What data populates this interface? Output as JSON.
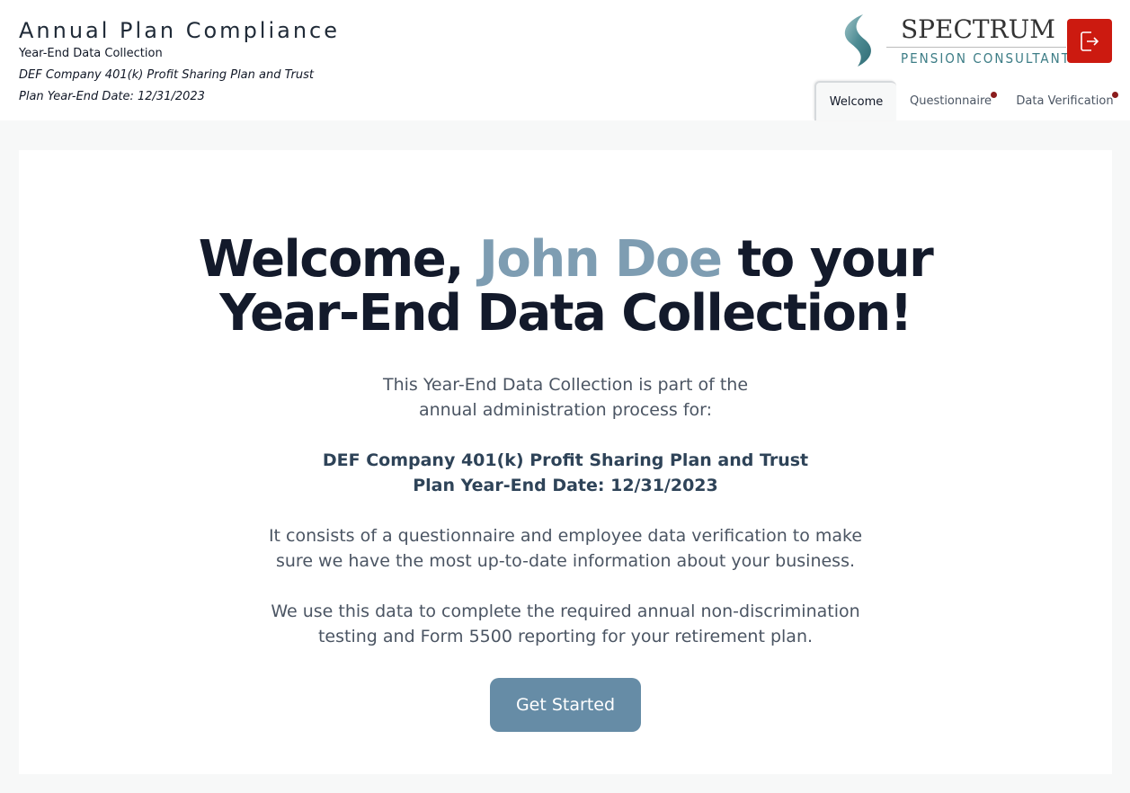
{
  "header": {
    "app_title": "Annual Plan Compliance",
    "app_subtitle": "Year-End Data Collection",
    "plan_name": "DEF Company 401(k) Profit Sharing Plan and Trust",
    "plan_date": "Plan Year-End Date: 12/31/2023"
  },
  "logo": {
    "word": "SPECTRUM",
    "sub": "PENSION CONSULTANTS"
  },
  "tabs": [
    {
      "label": "Welcome",
      "active": true,
      "has_alert": false
    },
    {
      "label": "Questionnaire",
      "active": false,
      "has_alert": true
    },
    {
      "label": "Data Verification",
      "active": false,
      "has_alert": true
    }
  ],
  "main": {
    "headline_prefix": "Welcome, ",
    "user_name": "John Doe",
    "headline_suffix": " to your",
    "headline_line2": "Year-End Data Collection!",
    "intro_line1": "This Year-End Data Collection is part of the",
    "intro_line2": "annual administration process for:",
    "plan_name": "DEF Company 401(k) Profit Sharing Plan and Trust",
    "plan_date": "Plan Year-End Date: 12/31/2023",
    "consists_line1": "It consists of a questionnaire and employee data verification to make",
    "consists_line2": "sure we have the most up-to-date information about your business.",
    "usage_line1": "We use this data to complete the required annual non-discrimination",
    "usage_line2": "testing and Form 5500 reporting for your retirement plan.",
    "cta_label": "Get Started"
  },
  "colors": {
    "accent": "#668ca6",
    "name_highlight": "#7e9db2",
    "logout": "#cc1a10",
    "alert_dot": "#8b1d1d",
    "logo_teal": "#3d7d86"
  },
  "icons": {
    "logout": "logout-icon",
    "logo_mark": "spectrum-logo-mark"
  }
}
